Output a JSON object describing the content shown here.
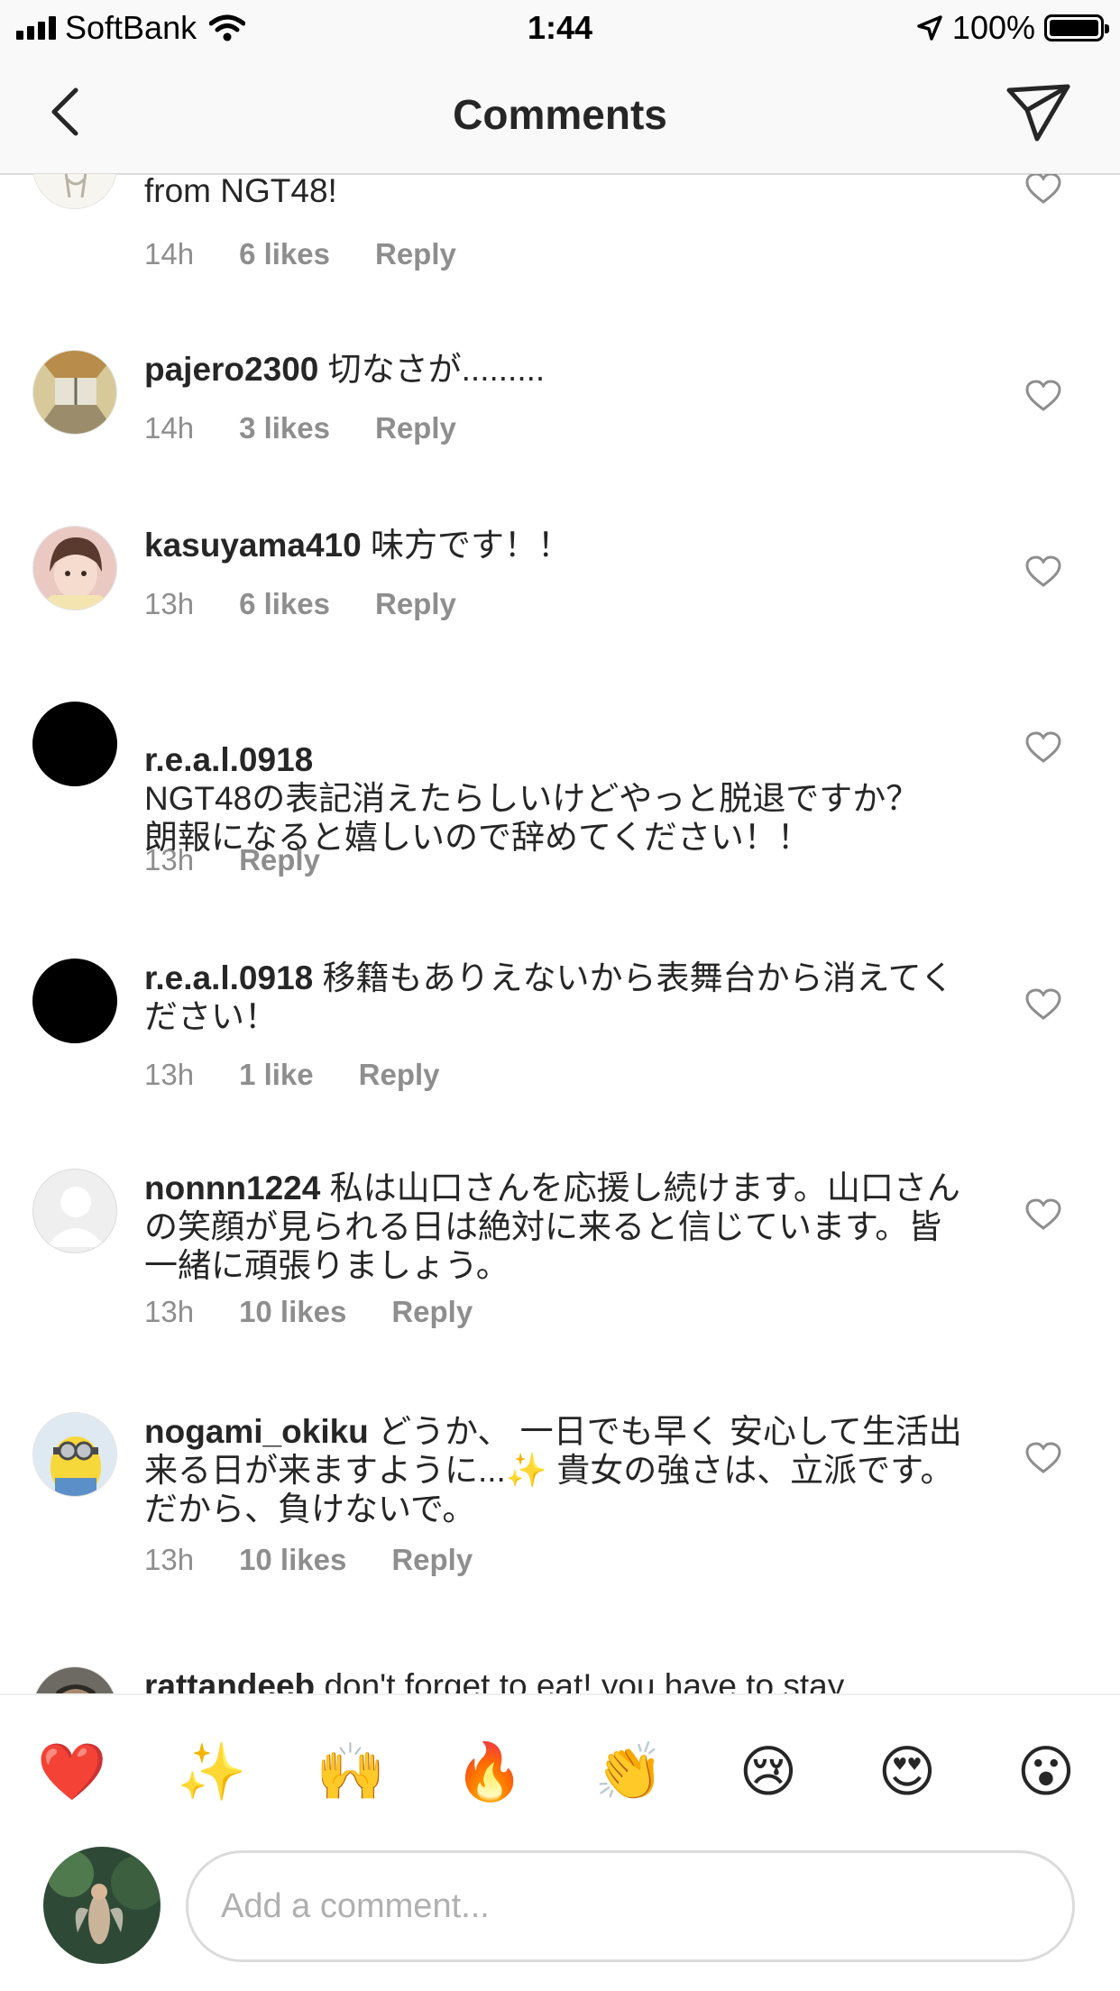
{
  "status_bar": {
    "carrier": "SoftBank",
    "time": "1:44",
    "battery": "100%"
  },
  "header": {
    "title": "Comments"
  },
  "comments": [
    {
      "username": "",
      "text": "from NGT48!",
      "time": "14h",
      "likes": "6 likes",
      "reply": "Reply",
      "avatar": "sketch-avatar"
    },
    {
      "username": "pajero2300",
      "text": "切なさが.........",
      "time": "14h",
      "likes": "3 likes",
      "reply": "Reply",
      "avatar": "corridor-photo-avatar"
    },
    {
      "username": "kasuyama410",
      "text": "味方です！！",
      "time": "13h",
      "likes": "6 likes",
      "reply": "Reply",
      "avatar": "girl-photo-avatar"
    },
    {
      "username": "r.e.a.l.0918",
      "text": "NGT48の表記消えたらしいけどやっと脱退ですか？\n朗報になると嬉しいので辞めてください！！",
      "time": "13h",
      "likes": "",
      "reply": "Reply",
      "avatar": "black-avatar"
    },
    {
      "username": "r.e.a.l.0918",
      "text": "移籍もありえないから表舞台から消えてください！",
      "time": "13h",
      "likes": "1 like",
      "reply": "Reply",
      "avatar": "black-avatar"
    },
    {
      "username": "nonnn1224",
      "text": "私は山口さんを応援し続けます。山口さんの笑顔が見られる日は絶対に来ると信じています。皆一緒に頑張りましょう。",
      "time": "13h",
      "likes": "10 likes",
      "reply": "Reply",
      "avatar": "default-avatar"
    },
    {
      "username": "nogami_okiku",
      "text": "どうか、 一日でも早く 安心して生活出来る日が来ますように...✨ 貴女の強さは、立派です。だから、負けないで。",
      "time": "13h",
      "likes": "10 likes",
      "reply": "Reply",
      "avatar": "minion-avatar"
    },
    {
      "username": "rattandeeb",
      "text": "don't forget to eat! you have to stay",
      "time": "",
      "likes": "",
      "reply": "",
      "avatar": "man-photo-avatar"
    }
  ],
  "emoji_bar": [
    "❤️",
    "✨",
    "🙌",
    "🔥",
    "👏",
    "😢",
    "😍",
    "😮"
  ],
  "composer": {
    "placeholder": "Add a comment..."
  },
  "colors": {
    "text": "#262626",
    "meta": "#8e8e8e",
    "divider": "#dbdbdb",
    "bar_background": "#f9f9f9"
  }
}
